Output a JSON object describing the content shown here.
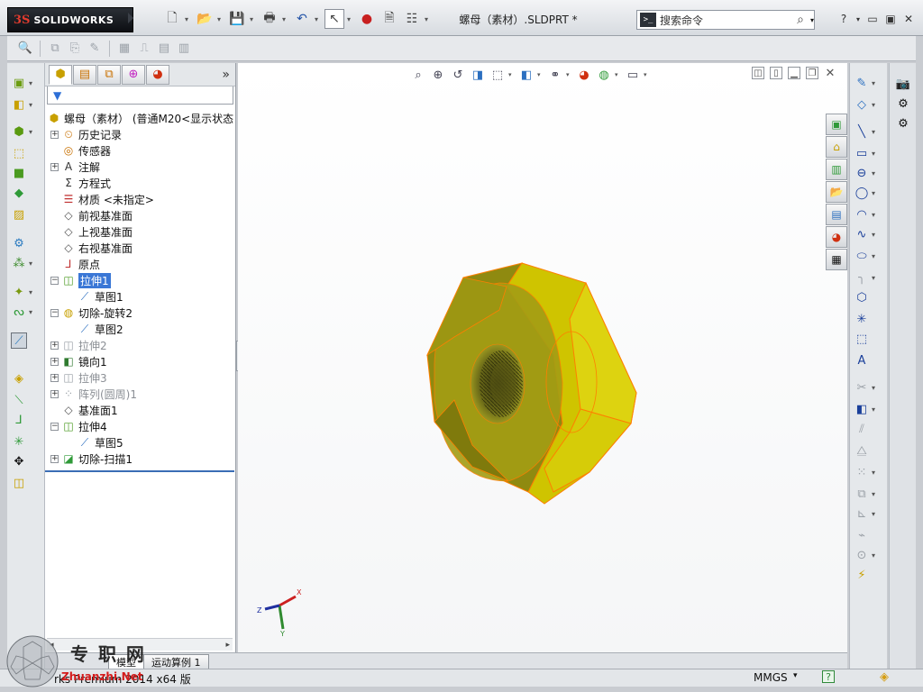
{
  "app": {
    "brand": "SOLIDWORKS",
    "brand_mark": "3S",
    "document_title": "螺母（素材）.SLDPRT *"
  },
  "search": {
    "placeholder": "搜索命令"
  },
  "feature_tabs": [
    "feature-manager",
    "property-manager",
    "configuration-manager",
    "dimxpert-manager",
    "display-manager"
  ],
  "tree": {
    "root": "螺母（素材） (普通M20<显示状态",
    "nodes": [
      {
        "label": "历史记录",
        "icon": "history-icon",
        "level": 0,
        "expand": true,
        "state": "normal"
      },
      {
        "label": "传感器",
        "icon": "sensor-icon",
        "level": 0,
        "expand": false,
        "state": "normal"
      },
      {
        "label": "注解",
        "icon": "annotation-icon",
        "level": 0,
        "expand": true,
        "state": "normal"
      },
      {
        "label": "方程式",
        "icon": "equation-icon",
        "level": 0,
        "expand": false,
        "state": "normal"
      },
      {
        "label": "材质 <未指定>",
        "icon": "material-icon",
        "level": 0,
        "expand": false,
        "state": "normal"
      },
      {
        "label": "前视基准面",
        "icon": "plane-icon",
        "level": 0,
        "expand": false,
        "state": "normal"
      },
      {
        "label": "上视基准面",
        "icon": "plane-icon",
        "level": 0,
        "expand": false,
        "state": "normal"
      },
      {
        "label": "右视基准面",
        "icon": "plane-icon",
        "level": 0,
        "expand": false,
        "state": "normal"
      },
      {
        "label": "原点",
        "icon": "origin-icon",
        "level": 0,
        "expand": false,
        "state": "normal"
      },
      {
        "label": "拉伸1",
        "icon": "extrude-icon",
        "level": 0,
        "expand": true,
        "state": "selected"
      },
      {
        "label": "草图1",
        "icon": "sketch-icon",
        "level": 1,
        "expand": false,
        "state": "normal"
      },
      {
        "label": "切除-旋转2",
        "icon": "revolve-cut-icon",
        "level": 0,
        "expand": true,
        "state": "normal"
      },
      {
        "label": "草图2",
        "icon": "sketch-icon",
        "level": 1,
        "expand": false,
        "state": "normal"
      },
      {
        "label": "拉伸2",
        "icon": "extrude-icon",
        "level": 0,
        "expand": true,
        "state": "dim"
      },
      {
        "label": "镜向1",
        "icon": "mirror-icon",
        "level": 0,
        "expand": true,
        "state": "normal"
      },
      {
        "label": "拉伸3",
        "icon": "extrude-icon",
        "level": 0,
        "expand": true,
        "state": "dim"
      },
      {
        "label": "阵列(圆周)1",
        "icon": "circular-pattern-icon",
        "level": 0,
        "expand": true,
        "state": "dim"
      },
      {
        "label": "基准面1",
        "icon": "plane-icon",
        "level": 0,
        "expand": false,
        "state": "normal"
      },
      {
        "label": "拉伸4",
        "icon": "extrude-icon",
        "level": 0,
        "expand": true,
        "state": "normal"
      },
      {
        "label": "草图5",
        "icon": "sketch-icon",
        "level": 1,
        "expand": false,
        "state": "normal"
      },
      {
        "label": "切除-扫描1",
        "icon": "sweep-cut-icon",
        "level": 0,
        "expand": true,
        "state": "normal"
      }
    ]
  },
  "bottom_tabs": [
    "模型",
    "运动算例 1"
  ],
  "status": {
    "left": "rks Premium 2014 x64 版",
    "units": "MMGS",
    "help": "?"
  },
  "triad": {
    "x": "X",
    "y": "Y",
    "z": "Z"
  },
  "watermark": {
    "line1": "专 职 网",
    "line2": "Zhuanzhi.Net"
  },
  "colors": {
    "part_yellow": "#d8d000",
    "edge_orange": "#ff7f00",
    "selection_blue": "#3a77d6"
  }
}
